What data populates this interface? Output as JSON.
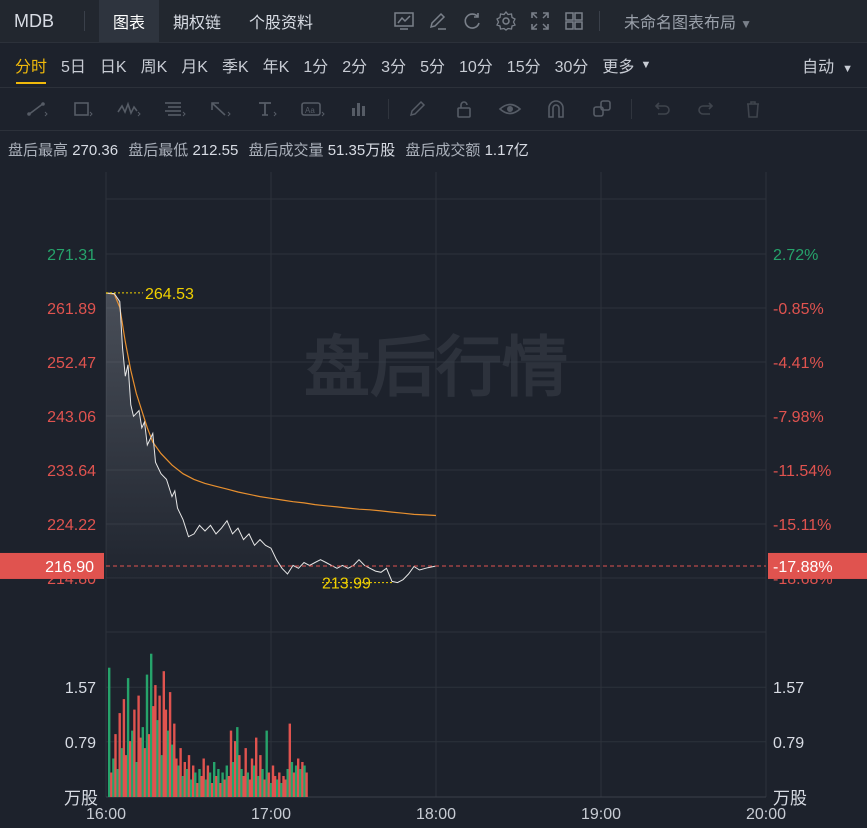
{
  "topbar": {
    "ticker": "MDB",
    "tabs": [
      {
        "label": "图表",
        "active": true
      },
      {
        "label": "期权链",
        "active": false
      },
      {
        "label": "个股资料",
        "active": false
      }
    ],
    "icons": [
      "chart-style-icon",
      "draw-icon",
      "refresh-icon",
      "settings-icon",
      "fullscreen-icon",
      "layout-grid-icon"
    ],
    "layout_name": "未命名图表布局"
  },
  "periods": {
    "items": [
      "分时",
      "5日",
      "日K",
      "周K",
      "月K",
      "季K",
      "年K",
      "1分",
      "2分",
      "3分",
      "5分",
      "10分",
      "15分",
      "30分"
    ],
    "active": "分时",
    "more_label": "更多",
    "auto_label": "自动"
  },
  "toolbar": {
    "tools": [
      "trendline-icon",
      "rectangle-icon",
      "wave-icon",
      "fib-icon",
      "arrow-icon",
      "text-icon",
      "label-icon",
      "bars-icon",
      "pen-icon",
      "lock-icon",
      "eye-icon",
      "magnet-icon",
      "layers-icon",
      "undo-icon",
      "redo-icon",
      "trash-icon"
    ]
  },
  "info": {
    "high_label": "盘后最高",
    "high_value": "270.36",
    "low_label": "盘后最低",
    "low_value": "212.55",
    "volume_label": "盘后成交量",
    "volume_value": "51.35万股",
    "amount_label": "盘后成交额",
    "amount_value": "1.17亿"
  },
  "colors": {
    "up": "#26a36b",
    "down": "#e0534f",
    "avg_line": "#e8902f",
    "price_line": "#e6e6e6",
    "grid": "#2d323b",
    "marker": "#f0d000",
    "current_badge": "#e0534f"
  },
  "chart_data": {
    "type": "line",
    "watermark": "盘后行情",
    "price_ticks": [
      "271.31",
      "261.89",
      "252.47",
      "243.06",
      "233.64",
      "224.22",
      "214.80"
    ],
    "pct_ticks": [
      "2.72%",
      "-0.85%",
      "-4.41%",
      "-7.98%",
      "-11.54%",
      "-15.11%",
      "-18.68%"
    ],
    "ylim": [
      214.8,
      271.31
    ],
    "current_price": "216.90",
    "current_pct": "-17.88%",
    "high_marker": "264.53",
    "low_marker": "213.99",
    "x_ticks": [
      "16:00",
      "17:00",
      "18:00",
      "19:00",
      "20:00"
    ],
    "x_range_minutes": [
      0,
      240
    ],
    "price_series": [
      [
        0,
        264.5
      ],
      [
        3,
        264.4
      ],
      [
        5,
        263.0
      ],
      [
        6,
        255
      ],
      [
        7,
        250
      ],
      [
        8,
        252
      ],
      [
        9,
        245
      ],
      [
        10,
        243
      ],
      [
        12,
        244
      ],
      [
        13,
        241
      ],
      [
        14,
        242
      ],
      [
        15,
        238
      ],
      [
        17,
        240
      ],
      [
        18,
        235
      ],
      [
        20,
        233
      ],
      [
        22,
        232
      ],
      [
        24,
        229
      ],
      [
        25,
        230
      ],
      [
        26,
        227
      ],
      [
        28,
        225
      ],
      [
        30,
        222
      ],
      [
        32,
        222.5
      ],
      [
        34,
        224
      ],
      [
        36,
        223
      ],
      [
        38,
        224
      ],
      [
        40,
        222.5
      ],
      [
        42,
        223.5
      ],
      [
        44,
        224.8
      ],
      [
        46,
        222.5
      ],
      [
        48,
        223.5
      ],
      [
        50,
        221.5
      ],
      [
        52,
        222.5
      ],
      [
        54,
        220.5
      ],
      [
        56,
        221.5
      ],
      [
        58,
        220.5
      ],
      [
        60,
        220
      ],
      [
        62,
        218
      ],
      [
        64,
        216.5
      ],
      [
        66,
        215.5
      ],
      [
        68,
        217
      ],
      [
        70,
        216.5
      ],
      [
        72,
        217.5
      ],
      [
        74,
        217
      ],
      [
        76,
        217.5
      ],
      [
        78,
        218
      ],
      [
        80,
        217.5
      ],
      [
        82,
        217
      ],
      [
        84,
        216.5
      ],
      [
        86,
        217
      ],
      [
        88,
        216.5
      ],
      [
        90,
        217
      ],
      [
        92,
        218
      ],
      [
        94,
        217
      ],
      [
        96,
        216.5
      ],
      [
        98,
        216
      ],
      [
        100,
        215.8
      ],
      [
        102,
        216.5
      ],
      [
        104,
        214.2
      ],
      [
        106,
        214
      ],
      [
        108,
        214.5
      ],
      [
        110,
        215.5
      ],
      [
        112,
        216.8
      ],
      [
        114,
        216.2
      ],
      [
        117,
        216.6
      ],
      [
        120,
        216.9
      ]
    ],
    "avg_series": [
      [
        0,
        264.5
      ],
      [
        3,
        264.3
      ],
      [
        5,
        262
      ],
      [
        7,
        256
      ],
      [
        9,
        251
      ],
      [
        11,
        247
      ],
      [
        13,
        244
      ],
      [
        15,
        241
      ],
      [
        17,
        238.5
      ],
      [
        20,
        236.5
      ],
      [
        24,
        234.5
      ],
      [
        28,
        233
      ],
      [
        32,
        232
      ],
      [
        36,
        231.3
      ],
      [
        40,
        230.8
      ],
      [
        44,
        230.3
      ],
      [
        48,
        229.8
      ],
      [
        52,
        229.4
      ],
      [
        56,
        229
      ],
      [
        60,
        228.7
      ],
      [
        64,
        228.4
      ],
      [
        68,
        228.1
      ],
      [
        72,
        227.9
      ],
      [
        76,
        227.6
      ],
      [
        80,
        227.4
      ],
      [
        84,
        227.2
      ],
      [
        88,
        227
      ],
      [
        92,
        226.8
      ],
      [
        96,
        226.7
      ],
      [
        100,
        226.5
      ],
      [
        104,
        226.3
      ],
      [
        108,
        226.1
      ],
      [
        112,
        225.9
      ],
      [
        116,
        225.8
      ],
      [
        120,
        225.7
      ]
    ],
    "volume_unit": "万股",
    "volume_ticks": [
      "1.57",
      "0.79"
    ],
    "volume_ylim": [
      0,
      2.36
    ],
    "volumes": [
      {
        "v": 1.85,
        "up": true
      },
      {
        "v": 0.35,
        "up": false
      },
      {
        "v": 0.55,
        "up": true
      },
      {
        "v": 0.9,
        "up": false
      },
      {
        "v": 0.4,
        "up": true
      },
      {
        "v": 1.2,
        "up": false
      },
      {
        "v": 0.7,
        "up": true
      },
      {
        "v": 1.4,
        "up": false
      },
      {
        "v": 0.6,
        "up": false
      },
      {
        "v": 1.7,
        "up": true
      },
      {
        "v": 0.8,
        "up": false
      },
      {
        "v": 0.95,
        "up": true
      },
      {
        "v": 1.25,
        "up": false
      },
      {
        "v": 0.5,
        "up": true
      },
      {
        "v": 1.45,
        "up": false
      },
      {
        "v": 0.85,
        "up": false
      },
      {
        "v": 1.0,
        "up": true
      },
      {
        "v": 0.7,
        "up": false
      },
      {
        "v": 1.75,
        "up": true
      },
      {
        "v": 0.9,
        "up": false
      },
      {
        "v": 2.05,
        "up": true
      },
      {
        "v": 1.3,
        "up": false
      },
      {
        "v": 1.6,
        "up": false
      },
      {
        "v": 1.1,
        "up": true
      },
      {
        "v": 1.45,
        "up": false
      },
      {
        "v": 0.6,
        "up": true
      },
      {
        "v": 1.8,
        "up": false
      },
      {
        "v": 1.25,
        "up": false
      },
      {
        "v": 0.95,
        "up": true
      },
      {
        "v": 1.5,
        "up": false
      },
      {
        "v": 0.75,
        "up": true
      },
      {
        "v": 1.05,
        "up": false
      },
      {
        "v": 0.55,
        "up": false
      },
      {
        "v": 0.45,
        "up": true
      },
      {
        "v": 0.7,
        "up": false
      },
      {
        "v": 0.3,
        "up": true
      },
      {
        "v": 0.5,
        "up": false
      },
      {
        "v": 0.4,
        "up": true
      },
      {
        "v": 0.6,
        "up": false
      },
      {
        "v": 0.25,
        "up": true
      },
      {
        "v": 0.45,
        "up": false
      },
      {
        "v": 0.35,
        "up": true
      },
      {
        "v": 0.2,
        "up": false
      },
      {
        "v": 0.4,
        "up": true
      },
      {
        "v": 0.3,
        "up": false
      },
      {
        "v": 0.55,
        "up": false
      },
      {
        "v": 0.25,
        "up": true
      },
      {
        "v": 0.45,
        "up": false
      },
      {
        "v": 0.35,
        "up": true
      },
      {
        "v": 0.2,
        "up": false
      },
      {
        "v": 0.5,
        "up": true
      },
      {
        "v": 0.3,
        "up": false
      },
      {
        "v": 0.4,
        "up": true
      },
      {
        "v": 0.2,
        "up": false
      },
      {
        "v": 0.35,
        "up": true
      },
      {
        "v": 0.25,
        "up": false
      },
      {
        "v": 0.45,
        "up": true
      },
      {
        "v": 0.3,
        "up": false
      },
      {
        "v": 0.95,
        "up": false
      },
      {
        "v": 0.5,
        "up": true
      },
      {
        "v": 0.8,
        "up": false
      },
      {
        "v": 1.0,
        "up": true
      },
      {
        "v": 0.6,
        "up": false
      },
      {
        "v": 0.4,
        "up": true
      },
      {
        "v": 0.3,
        "up": false
      },
      {
        "v": 0.7,
        "up": false
      },
      {
        "v": 0.35,
        "up": true
      },
      {
        "v": 0.25,
        "up": false
      },
      {
        "v": 0.55,
        "up": false
      },
      {
        "v": 0.45,
        "up": true
      },
      {
        "v": 0.85,
        "up": false
      },
      {
        "v": 0.3,
        "up": true
      },
      {
        "v": 0.6,
        "up": false
      },
      {
        "v": 0.4,
        "up": true
      },
      {
        "v": 0.25,
        "up": false
      },
      {
        "v": 0.95,
        "up": true
      },
      {
        "v": 0.35,
        "up": false
      },
      {
        "v": 0.2,
        "up": true
      },
      {
        "v": 0.45,
        "up": false
      },
      {
        "v": 0.3,
        "up": false
      },
      {
        "v": 0.25,
        "up": true
      },
      {
        "v": 0.35,
        "up": false
      },
      {
        "v": 0.2,
        "up": true
      },
      {
        "v": 0.3,
        "up": false
      },
      {
        "v": 0.25,
        "up": false
      },
      {
        "v": 0.4,
        "up": true
      },
      {
        "v": 1.05,
        "up": false
      },
      {
        "v": 0.5,
        "up": true
      },
      {
        "v": 0.35,
        "up": false
      },
      {
        "v": 0.45,
        "up": true
      },
      {
        "v": 0.55,
        "up": false
      },
      {
        "v": 0.4,
        "up": true
      },
      {
        "v": 0.5,
        "up": false
      },
      {
        "v": 0.45,
        "up": true
      },
      {
        "v": 0.35,
        "up": false
      }
    ]
  }
}
